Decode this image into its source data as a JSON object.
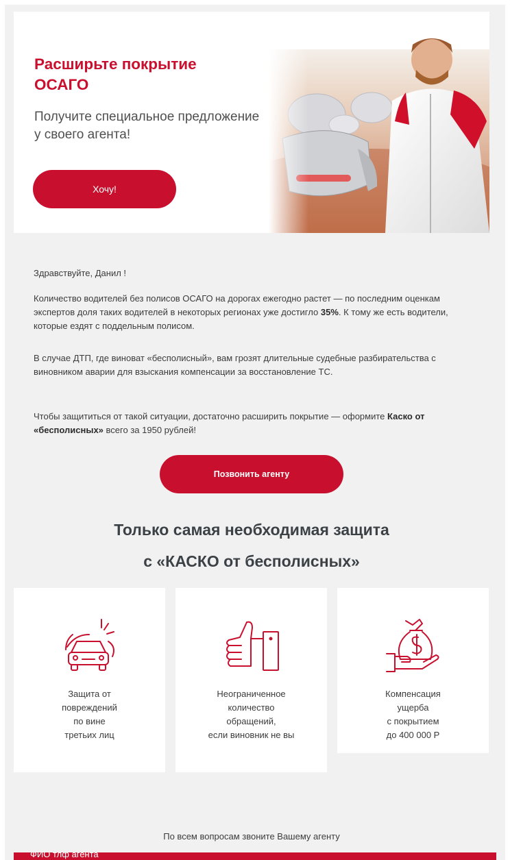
{
  "hero": {
    "title": "Расширьте покрытие ОСАГО",
    "subtitle": "Получите специальное предложение у своего агента!",
    "cta_label": "Хочу!"
  },
  "letter": {
    "greeting": "Здравствуйте, Данил !",
    "para1": "Количество водителей без полисов ОСАГО на дорогах ежегодно растет — по последним оценкам экспертов доля таких водителей в некоторых регионах уже достигло",
    "para1_bold": "35%",
    "para1_tail": ". К тому же есть водители, которые ездят с поддельным полисом.",
    "para2": "В случае ДТП, где виноват «бесполисный», вам грозят длительные судебные разбирательства с виновником аварии для взыскания компенсации за восстановление ТС.",
    "para3_start": "Чтобы защититься от такой ситуации, достаточно расширить покрытие — оформите",
    "para3_bold": "Каско от «бесполисных»",
    "para3_end": "всего за 1950 рублей!"
  },
  "call_button_label": "Позвонить агенту",
  "section": {
    "title_line1": "Только самая необходимая защита",
    "title_line2": "с «КАСКО от бесполисных»"
  },
  "features": [
    {
      "icon": "car-crash-icon",
      "l1": "Защита от",
      "l2": "повреждений",
      "l3": "по вине",
      "l4": "третьих лиц"
    },
    {
      "icon": "thumbs-up-icon",
      "l1": "Неограниченное",
      "l2": "количество",
      "l3": "обращений,",
      "l4": "если виновник не вы"
    },
    {
      "icon": "money-bag-hand-icon",
      "l1": "Компенсация",
      "l2": "ущерба",
      "l3": "с покрытием",
      "l4": "до 400 000 Р"
    }
  ],
  "footer": {
    "note": "По всем вопросам звоните Вашему агенту",
    "agent_line": "ФИО тлф агента"
  },
  "colors": {
    "accent": "#c8102e",
    "background": "#f1f1f2"
  }
}
